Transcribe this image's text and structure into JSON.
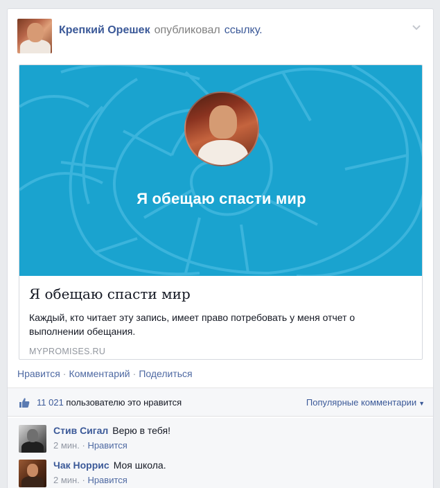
{
  "post": {
    "author": "Крепкий Орешек",
    "verb": "опубликовал",
    "link_word": "ссылку",
    "dot": "."
  },
  "share": {
    "hero_title": "Я обещаю спасти мир",
    "title": "Я обещаю спасти мир",
    "description": "Каждый, кто читает эту запись, имеет право потребовать у меня отчет о выполнении обещания.",
    "domain": "MYPROMISES.RU"
  },
  "actions": {
    "like": "Нравится",
    "comment": "Комментарий",
    "share": "Поделиться",
    "separator": "·"
  },
  "likes": {
    "count": "11 021",
    "text": "пользователю это нравится",
    "sort_label": "Популярные комментарии",
    "caret": "▼"
  },
  "comments": [
    {
      "author": "Стив Сигал",
      "text": "Верю в тебя!",
      "time": "2 мин.",
      "like": "Нравится",
      "separator": "·"
    },
    {
      "author": "Чак Норрис",
      "text": "Моя школа.",
      "time": "2 мин.",
      "like": "Нравится",
      "separator": "·"
    }
  ],
  "colors": {
    "link_blue": "#3b5998",
    "hero_bg": "#1aa3cf",
    "muted": "#9197a3"
  },
  "icons": {
    "chevron": "chevron-down-icon",
    "thumb": "thumbs-up-icon"
  }
}
